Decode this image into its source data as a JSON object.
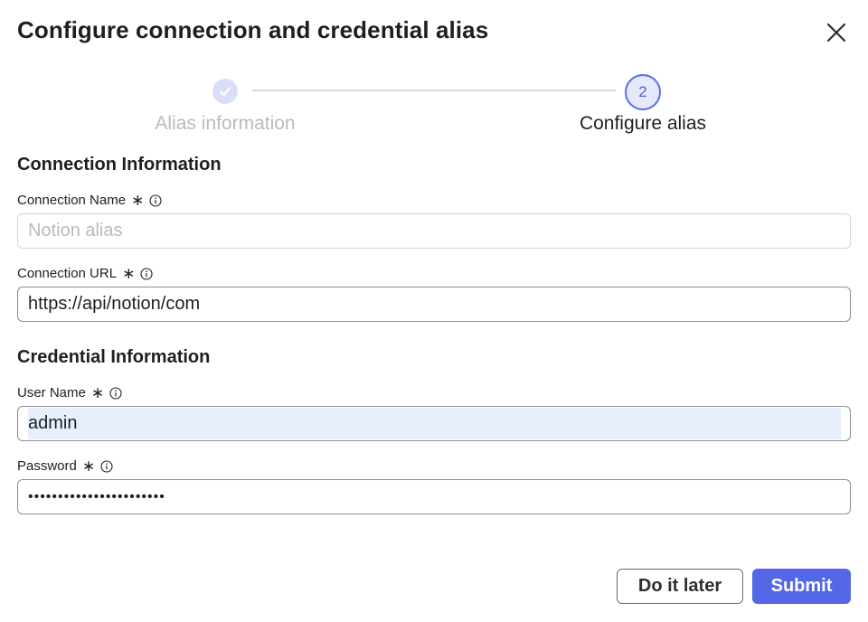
{
  "dialog": {
    "title": "Configure connection and credential alias"
  },
  "stepper": {
    "steps": [
      {
        "label": "Alias information",
        "state": "completed",
        "icon": "check-icon"
      },
      {
        "label": "Configure alias",
        "state": "active",
        "number": "2"
      }
    ]
  },
  "connection": {
    "section_title": "Connection Information",
    "name": {
      "label": "Connection Name",
      "required": "∗",
      "placeholder": "Notion alias",
      "value": ""
    },
    "url": {
      "label": "Connection URL",
      "required": "∗",
      "value": "https://api/notion/com"
    }
  },
  "credential": {
    "section_title": "Credential Information",
    "username": {
      "label": "User Name",
      "required": "∗",
      "value": "admin"
    },
    "password": {
      "label": "Password",
      "required": "∗",
      "value": "•••••••••••••••••••••••"
    }
  },
  "actions": {
    "later_label": "Do it later",
    "submit_label": "Submit"
  },
  "colors": {
    "accent": "#5468e7",
    "autofill": "#e7eefc",
    "muted_text": "#b9bac1"
  }
}
